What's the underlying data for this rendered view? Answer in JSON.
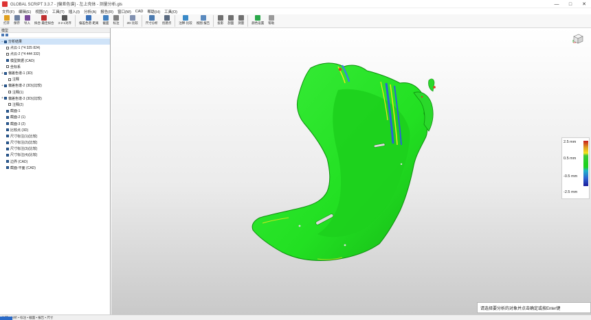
{
  "window": {
    "title": "GLOBAL SCRIPT 3.3.7 - [偏差色谱] - 左上壳体 - 测量分析.gls",
    "controls": [
      "—",
      "□",
      "✕"
    ]
  },
  "menu": [
    "文件(F)",
    "编辑(E)",
    "视图(V)",
    "工具(T)",
    "插入(I)",
    "分析(A)",
    "报告(R)",
    "窗口(W)",
    "CAD",
    "帮助(H)",
    "工具(O)"
  ],
  "toolbar": [
    {
      "label": "打开",
      "icon": "folder-icon",
      "color": "#e0a020"
    },
    {
      "label": "保存",
      "icon": "save-icon",
      "color": "#6c7fa0"
    },
    {
      "label": "导入",
      "icon": "import-icon",
      "color": "#7a4a9a"
    },
    {
      "label": "拟合·最佳拟合",
      "icon": "fit-icon",
      "color": "#c03030"
    },
    {
      "label": "3-2-1对齐",
      "icon": "align-icon",
      "color": "#555555"
    },
    {
      "sep": true
    },
    {
      "label": "偏差色谱·距离",
      "icon": "deviation-icon",
      "color": "#3a70b8"
    },
    {
      "label": "截面",
      "icon": "section-icon",
      "color": "#4080c0"
    },
    {
      "label": "标注",
      "icon": "annotate-icon",
      "color": "#808080"
    },
    {
      "sep": true
    },
    {
      "label": "2D·比较",
      "icon": "compare-2d-icon",
      "color": "#8090b0"
    },
    {
      "sep": true
    },
    {
      "label": "尺寸分析",
      "icon": "dimension-icon",
      "color": "#4a7ab0"
    },
    {
      "label": "创建点",
      "icon": "point-icon",
      "color": "#5a6a80"
    },
    {
      "sep": true
    },
    {
      "label": "注释·比较",
      "icon": "gdt-icon",
      "color": "#3a8ac8"
    },
    {
      "label": "视图·报告",
      "icon": "report-icon",
      "color": "#5a8abf"
    },
    {
      "sep": true
    },
    {
      "label": "投影",
      "icon": "projection-icon",
      "color": "#707070"
    },
    {
      "label": "剖面",
      "icon": "profile-icon",
      "color": "#707070"
    },
    {
      "label": "测量",
      "icon": "measure-icon",
      "color": "#707070"
    },
    {
      "sep": true
    },
    {
      "label": "颜色设置",
      "icon": "color-settings-icon",
      "color": "#2aa84a"
    },
    {
      "label": "帮助",
      "icon": "help-icon",
      "color": "#9a9a9a"
    }
  ],
  "panel": {
    "header": "模型",
    "tree": [
      {
        "label": "分析结果",
        "expander": "−",
        "checked": true,
        "selected": true,
        "indent": 0
      },
      {
        "label": "点云-1 (*4 325 824)",
        "expander": "",
        "checked": false,
        "indent": 1
      },
      {
        "label": "点云-2 (*4 444 332)",
        "expander": "",
        "checked": false,
        "indent": 1
      },
      {
        "label": "模型数据 (CAD)",
        "expander": "",
        "checked": true,
        "indent": 1
      },
      {
        "label": "坐标系",
        "expander": "",
        "checked": false,
        "indent": 1
      },
      {
        "label": "偏差色谱-1 (3D)",
        "expander": "+",
        "checked": true,
        "indent": 0
      },
      {
        "label": "注释",
        "expander": "",
        "checked": false,
        "indent": 2
      },
      {
        "label": "偏差色谱-2 (3D)(比较)",
        "expander": "+",
        "checked": true,
        "indent": 0
      },
      {
        "label": "注释(1)",
        "expander": "",
        "checked": false,
        "indent": 2
      },
      {
        "label": "偏差色谱-3 (3D)(比较)",
        "expander": "+",
        "checked": true,
        "indent": 0
      },
      {
        "label": "注释(2)",
        "expander": "",
        "checked": false,
        "indent": 2
      },
      {
        "label": "截面-1",
        "expander": "",
        "checked": true,
        "indent": 1
      },
      {
        "label": "截面-2 (1)",
        "expander": "",
        "checked": true,
        "indent": 1
      },
      {
        "label": "截面-3 (2)",
        "expander": "",
        "checked": true,
        "indent": 1
      },
      {
        "label": "比较点 (3D)",
        "expander": "",
        "checked": true,
        "indent": 1
      },
      {
        "label": "尺寸标注(1)(比较)",
        "expander": "",
        "checked": true,
        "indent": 1
      },
      {
        "label": "尺寸标注(2)(比较)",
        "expander": "",
        "checked": true,
        "indent": 1
      },
      {
        "label": "尺寸标注(3)(比较)",
        "expander": "",
        "checked": true,
        "indent": 1
      },
      {
        "label": "尺寸标注(4)(比较)",
        "expander": "",
        "checked": true,
        "indent": 1
      },
      {
        "label": "边界 (CAD)",
        "expander": "",
        "checked": true,
        "indent": 1
      },
      {
        "label": "截面-平面 (CAD)",
        "expander": "",
        "checked": true,
        "indent": 1
      }
    ]
  },
  "legend": {
    "labels": [
      "2.5 mm",
      "0.5 mm",
      "-0.5 mm",
      "-2.5 mm"
    ]
  },
  "notice": "请选择要分析的对象并点击确定或按Enter键",
  "status": "比较 • 分析 • 标注 • 截面 • 报告 • 尺寸",
  "colors": {
    "part_green": "#22e022",
    "part_dark_green": "#14a814",
    "deviation_blue": "#2a62d8",
    "deviation_yellow": "#f2e61c",
    "deviation_red": "#d83c28"
  }
}
